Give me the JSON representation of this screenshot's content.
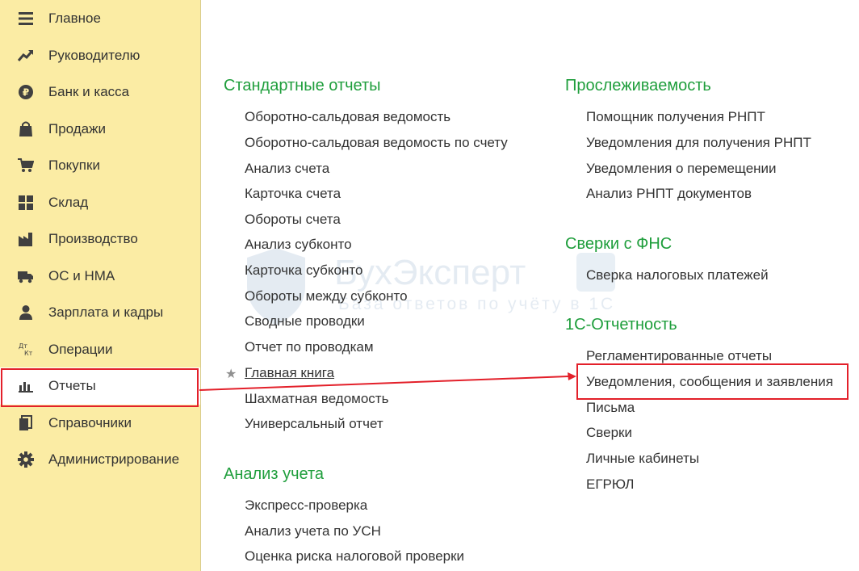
{
  "sidebar": {
    "items": [
      {
        "label": "Главное",
        "icon": "menu-lines-icon"
      },
      {
        "label": "Руководителю",
        "icon": "trend-chart-icon"
      },
      {
        "label": "Банк и касса",
        "icon": "ruble-coin-icon"
      },
      {
        "label": "Продажи",
        "icon": "shopping-bag-icon"
      },
      {
        "label": "Покупки",
        "icon": "shopping-cart-icon"
      },
      {
        "label": "Склад",
        "icon": "warehouse-grid-icon"
      },
      {
        "label": "Производство",
        "icon": "factory-icon"
      },
      {
        "label": "ОС и НМА",
        "icon": "truck-icon"
      },
      {
        "label": "Зарплата и кадры",
        "icon": "person-icon"
      },
      {
        "label": "Операции",
        "icon": "debit-credit-icon",
        "icon_text_top": "Дт",
        "icon_text_bottom": "Кт"
      },
      {
        "label": "Отчеты",
        "icon": "bar-chart-icon",
        "highlighted": true
      },
      {
        "label": "Справочники",
        "icon": "books-icon"
      },
      {
        "label": "Администрирование",
        "icon": "gear-icon"
      }
    ]
  },
  "sections": {
    "standard_reports": {
      "title": "Стандартные отчеты",
      "items": [
        "Оборотно-сальдовая ведомость",
        "Оборотно-сальдовая ведомость по счету",
        "Анализ счета",
        "Карточка счета",
        "Обороты счета",
        "Анализ субконто",
        "Карточка субконто",
        "Обороты между субконто",
        "Сводные проводки",
        "Отчет по проводкам",
        "Главная книга",
        "Шахматная ведомость",
        "Универсальный отчет"
      ],
      "starred_item": "Главная книга"
    },
    "accounting_analysis": {
      "title": "Анализ учета",
      "items": [
        "Экспресс-проверка",
        "Анализ учета по УСН",
        "Оценка риска налоговой проверки"
      ]
    },
    "traceability": {
      "title": "Прослеживаемость",
      "items": [
        "Помощник получения РНПТ",
        "Уведомления для получения РНПТ",
        "Уведомления о перемещении",
        "Анализ РНПТ документов"
      ]
    },
    "fns_reconciliation": {
      "title": "Сверки с ФНС",
      "items": [
        "Сверка налоговых платежей"
      ]
    },
    "reporting_1c": {
      "title": "1С-Отчетность",
      "items": [
        "Регламентированные отчеты",
        "Уведомления, сообщения и заявления",
        "Письма",
        "Сверки",
        "Личные кабинеты",
        "ЕГРЮЛ"
      ],
      "highlighted_item": "Уведомления, сообщения и заявления"
    }
  },
  "watermark": {
    "title": "БухЭксперт",
    "subtitle": "База ответов по учёту в 1С"
  },
  "colors": {
    "sidebar_bg": "#fbeca4",
    "section_title": "#1f9e3c",
    "highlight": "#e3202a",
    "text": "#333333"
  }
}
